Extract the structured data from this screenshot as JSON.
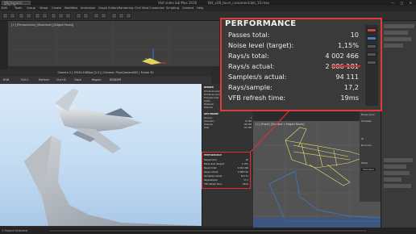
{
  "titlebar": {
    "workspace": "Workspace: Default",
    "file": "Vkd video lab Max 2016",
    "subtitle": "Bkt_v28_tours_crossment.bkt_10.max",
    "window_controls": "— □ ✕"
  },
  "menubar": {
    "items": [
      "Edit",
      "Tools",
      "Group",
      "Views",
      "Create",
      "Modifiers",
      "Animation",
      "Graph Editors",
      "Rendering",
      "Civil View",
      "Customize",
      "Scripting",
      "Content",
      "Help"
    ]
  },
  "upper_viewport": {
    "label": "[+] [Perspective] [Standard] [Edged Faces]"
  },
  "vfb": {
    "info": "Camera 2 | 1920×1080px [1:2] | Camera: PhysCamera002 | Frame 30",
    "toolbar_items": [
      "RGB",
      "Ctrl-C",
      "Refresh",
      "Ctrl+D",
      "Track",
      "Region",
      "RENDER"
    ]
  },
  "stats_panel": {
    "section1": "RENDER",
    "rows1": [
      {
        "label": "Primitives total",
        "value": "31 344"
      },
      {
        "label": "Primitives scene",
        "value": "30 988"
      },
      {
        "label": "Triangles total",
        "value": "29 700"
      },
      {
        "label": "Lights",
        "value": "3"
      },
      {
        "label": "Materials",
        "value": "24"
      },
      {
        "label": "Textures",
        "value": "12"
      }
    ],
    "section2": "GPU ENGINE",
    "rows2": [
      {
        "label": "Devices",
        "value": "1"
      },
      {
        "label": "Geometry",
        "value": "41 MB"
      },
      {
        "label": "Textures",
        "value": "160 MB"
      },
      {
        "label": "Total",
        "value": "210 MB"
      }
    ]
  },
  "mini_performance": {
    "title": "PERFORMANCE",
    "rows": [
      {
        "label": "Passes total:",
        "value": "10"
      },
      {
        "label": "Noise level (target):",
        "value": "1,15%"
      },
      {
        "label": "Rays/s total:",
        "value": "4 002 466"
      },
      {
        "label": "Rays/s actual:",
        "value": "2 086 181"
      },
      {
        "label": "Samples/s actual:",
        "value": "94 111"
      },
      {
        "label": "Rays/sample:",
        "value": "17,2"
      },
      {
        "label": "VFB refresh time:",
        "value": "19ms"
      }
    ]
  },
  "bottom_viewport": {
    "label": "[+] [Front] [Shaded + Edged Faces]"
  },
  "right_panel": {
    "labels": [
      "Environment",
      "Background",
      "Use Map",
      "Noise level",
      "Samples",
      "GI",
      "Bounces",
      "Mode",
      "Standard"
    ]
  },
  "performance": {
    "title": "PERFORMANCE",
    "rows": [
      {
        "label": "Passes total:",
        "value": "10"
      },
      {
        "label": "Noise level (target):",
        "value": "1,15%"
      },
      {
        "label": "Rays/s total:",
        "value": "4 002 466"
      },
      {
        "label": "Rays/s actual:",
        "value": "2 086 181"
      },
      {
        "label": "Samples/s actual:",
        "value": "94 111"
      },
      {
        "label": "Rays/sample:",
        "value": "17,2"
      },
      {
        "label": "VFB refresh time:",
        "value": "19ms"
      }
    ],
    "highlight_color": "#e03030"
  },
  "statusbar": {
    "selection": "1 Object Selected"
  },
  "colors": {
    "accent": "#e03030",
    "plane": "#c9cdd2",
    "wireframe": "#e8e46a"
  }
}
